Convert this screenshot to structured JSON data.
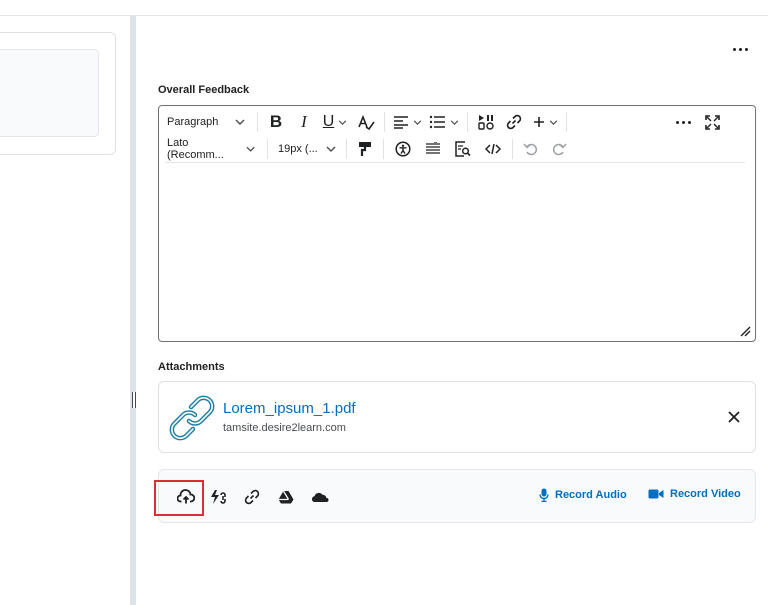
{
  "right_panel": {
    "more_label": "More actions",
    "feedback_label": "Overall Feedback",
    "attachments_label": "Attachments"
  },
  "editor": {
    "block_format": "Paragraph",
    "font_family": "Lato (Recomm...",
    "font_size": "19px (...",
    "toolbar_icons": [
      "bold-icon",
      "italic-icon",
      "underline-icon",
      "format-icon",
      "align-icon",
      "list-icon",
      "insert-stuff-icon",
      "link-icon",
      "add-icon",
      "more-icon",
      "fullscreen-icon",
      "format-painter-icon",
      "accessibility-icon",
      "line-spacing-icon",
      "find-icon",
      "source-code-icon",
      "undo-icon",
      "redo-icon"
    ],
    "content": ""
  },
  "attachment": {
    "name": "Lorem_ipsum_1.pdf",
    "site": "tamsite.desire2learn.com",
    "icon": "link-icon"
  },
  "upload_bar": {
    "icons": [
      "upload-icon",
      "quicklink-icon",
      "attach-link-icon",
      "google-drive-icon",
      "onedrive-icon"
    ],
    "record_audio": "Record Audio",
    "record_video": "Record Video",
    "highlighted": "upload-icon"
  },
  "colors": {
    "link": "#006fbf",
    "highlight": "#d93035",
    "border": "#6e7376"
  }
}
